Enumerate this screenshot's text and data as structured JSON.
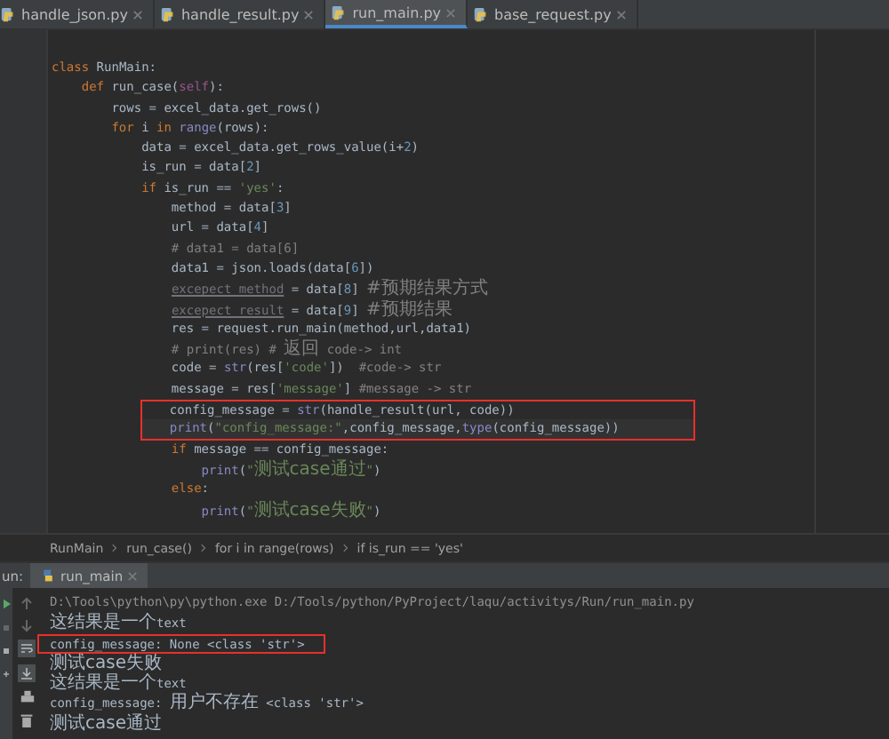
{
  "tabs": [
    {
      "label": "handle_json.py",
      "selected": false
    },
    {
      "label": "handle_result.py",
      "selected": false
    },
    {
      "label": "run_main.py",
      "selected": true
    },
    {
      "label": "base_request.py",
      "selected": false
    }
  ],
  "editor": {
    "lines": [
      {
        "current": false,
        "boxed": false,
        "tokens": [
          {
            "kind": "kw",
            "text": "class "
          },
          {
            "kind": "plain",
            "text": "RunMain:"
          }
        ]
      },
      {
        "current": false,
        "boxed": false,
        "tokens": [
          {
            "kind": "kw",
            "text": "    def "
          },
          {
            "kind": "plain",
            "text": "run_case("
          },
          {
            "kind": "self",
            "text": "self"
          },
          {
            "kind": "plain",
            "text": "):"
          }
        ]
      },
      {
        "current": false,
        "boxed": false,
        "tokens": [
          {
            "kind": "plain",
            "text": "        rows = excel_data.get_rows()"
          }
        ]
      },
      {
        "current": false,
        "boxed": false,
        "tokens": [
          {
            "kind": "kw",
            "text": "        for "
          },
          {
            "kind": "plain",
            "text": "i "
          },
          {
            "kind": "kw",
            "text": "in "
          },
          {
            "kind": "fn",
            "text": "range"
          },
          {
            "kind": "plain",
            "text": "(rows):"
          }
        ]
      },
      {
        "current": false,
        "boxed": false,
        "tokens": [
          {
            "kind": "plain",
            "text": "            data = excel_data.get_rows_value(i+"
          },
          {
            "kind": "num",
            "text": "2"
          },
          {
            "kind": "plain",
            "text": ")"
          }
        ]
      },
      {
        "current": false,
        "boxed": false,
        "tokens": [
          {
            "kind": "plain",
            "text": "            is_run = data["
          },
          {
            "kind": "num",
            "text": "2"
          },
          {
            "kind": "plain",
            "text": "]"
          }
        ]
      },
      {
        "current": false,
        "boxed": false,
        "tokens": [
          {
            "kind": "kw",
            "text": "            if "
          },
          {
            "kind": "plain",
            "text": "is_run == "
          },
          {
            "kind": "str",
            "text": "'yes'"
          },
          {
            "kind": "plain",
            "text": ":"
          }
        ]
      },
      {
        "current": false,
        "boxed": false,
        "tokens": [
          {
            "kind": "plain",
            "text": "                method = data["
          },
          {
            "kind": "num",
            "text": "3"
          },
          {
            "kind": "plain",
            "text": "]"
          }
        ]
      },
      {
        "current": false,
        "boxed": false,
        "tokens": [
          {
            "kind": "plain",
            "text": "                url = data["
          },
          {
            "kind": "num",
            "text": "4"
          },
          {
            "kind": "plain",
            "text": "]"
          }
        ]
      },
      {
        "current": false,
        "boxed": false,
        "tokens": [
          {
            "kind": "comment",
            "text": "                # data1 = data[6]"
          }
        ]
      },
      {
        "current": false,
        "boxed": false,
        "tokens": [
          {
            "kind": "plain",
            "text": "                data1 = json.loads(data["
          },
          {
            "kind": "num",
            "text": "6"
          },
          {
            "kind": "plain",
            "text": "])"
          }
        ]
      },
      {
        "current": false,
        "boxed": false,
        "tokens": [
          {
            "kind": "unused",
            "text": "                excepect_method"
          },
          {
            "kind": "plain",
            "text": " = data["
          },
          {
            "kind": "num",
            "text": "8"
          },
          {
            "kind": "plain",
            "text": "] "
          },
          {
            "kind": "comment-cjk",
            "text": "#预期结果方式"
          }
        ]
      },
      {
        "current": false,
        "boxed": false,
        "tokens": [
          {
            "kind": "unused",
            "text": "                excepect_result"
          },
          {
            "kind": "plain",
            "text": " = data["
          },
          {
            "kind": "num",
            "text": "9"
          },
          {
            "kind": "plain",
            "text": "] "
          },
          {
            "kind": "comment-cjk",
            "text": "#预期结果"
          }
        ]
      },
      {
        "current": false,
        "boxed": false,
        "tokens": [
          {
            "kind": "plain",
            "text": "                res = request.run_main(method,url,data1)"
          }
        ]
      },
      {
        "current": false,
        "boxed": false,
        "tokens": [
          {
            "kind": "comment",
            "text": "                # print(res) # "
          },
          {
            "kind": "comment-cjk",
            "text": "返回"
          },
          {
            "kind": "comment",
            "text": " code-> int"
          }
        ]
      },
      {
        "current": false,
        "boxed": false,
        "tokens": [
          {
            "kind": "plain",
            "text": "                code = "
          },
          {
            "kind": "fn",
            "text": "str"
          },
          {
            "kind": "plain",
            "text": "(res["
          },
          {
            "kind": "str",
            "text": "'code'"
          },
          {
            "kind": "plain",
            "text": "])  "
          },
          {
            "kind": "comment",
            "text": "#code-> str"
          }
        ]
      },
      {
        "current": false,
        "boxed": false,
        "tokens": [
          {
            "kind": "plain",
            "text": "                message = res["
          },
          {
            "kind": "str",
            "text": "'message'"
          },
          {
            "kind": "plain",
            "text": "] "
          },
          {
            "kind": "comment",
            "text": "#message -> str"
          }
        ]
      },
      {
        "current": false,
        "boxed": true,
        "tokens": [
          {
            "kind": "plain",
            "text": "                config_message = "
          },
          {
            "kind": "fn",
            "text": "str"
          },
          {
            "kind": "plain",
            "text": "(handle_result(url, code))"
          }
        ]
      },
      {
        "current": true,
        "boxed": true,
        "tokens": [
          {
            "kind": "fn",
            "text": "                print"
          },
          {
            "kind": "plain",
            "text": "("
          },
          {
            "kind": "str",
            "text": "\"config_message:\""
          },
          {
            "kind": "plain",
            "text": ",config_message,"
          },
          {
            "kind": "fn",
            "text": "type"
          },
          {
            "kind": "plain",
            "text": "(config_message))"
          }
        ]
      },
      {
        "current": false,
        "boxed": false,
        "tokens": [
          {
            "kind": "kw",
            "text": "                if "
          },
          {
            "kind": "plain",
            "text": "message == config_message:"
          }
        ]
      },
      {
        "current": false,
        "boxed": false,
        "tokens": [
          {
            "kind": "fn",
            "text": "                    print"
          },
          {
            "kind": "plain",
            "text": "("
          },
          {
            "kind": "str",
            "text": "\""
          },
          {
            "kind": "str-cjk",
            "text": "测试case通过"
          },
          {
            "kind": "str",
            "text": "\""
          },
          {
            "kind": "plain",
            "text": ")"
          }
        ]
      },
      {
        "current": false,
        "boxed": false,
        "tokens": [
          {
            "kind": "kw",
            "text": "                else"
          },
          {
            "kind": "plain",
            "text": ":"
          }
        ]
      },
      {
        "current": false,
        "boxed": false,
        "tokens": [
          {
            "kind": "fn",
            "text": "                    print"
          },
          {
            "kind": "plain",
            "text": "("
          },
          {
            "kind": "str",
            "text": "\""
          },
          {
            "kind": "str-cjk",
            "text": "测试case失败"
          },
          {
            "kind": "str",
            "text": "\""
          },
          {
            "kind": "plain",
            "text": ")"
          }
        ]
      }
    ]
  },
  "breadcrumbs": [
    "RunMain",
    "run_case()",
    "for i in range(rows)",
    "if is_run == 'yes'"
  ],
  "run_panel": {
    "label": "un:",
    "tab": "run_main",
    "console": [
      {
        "boxed": false,
        "kind": "command",
        "tokens": [
          {
            "kind": "latin",
            "text": "D:\\Tools\\python\\py\\python.exe D:/Tools/python/PyProject/laqu/activitys/Run/run_main.py"
          }
        ]
      },
      {
        "boxed": false,
        "kind": "output",
        "tokens": [
          {
            "kind": "cjk",
            "text": "这结果是一个"
          },
          {
            "kind": "latin",
            "text": "text"
          }
        ]
      },
      {
        "boxed": true,
        "kind": "output",
        "tokens": [
          {
            "kind": "latin",
            "text": "config_message: None <class 'str'>"
          }
        ]
      },
      {
        "boxed": false,
        "kind": "output",
        "tokens": [
          {
            "kind": "cjk",
            "text": "测试case失败"
          }
        ]
      },
      {
        "boxed": false,
        "kind": "output",
        "tokens": [
          {
            "kind": "cjk",
            "text": "这结果是一个"
          },
          {
            "kind": "latin",
            "text": "text"
          }
        ]
      },
      {
        "boxed": false,
        "kind": "output",
        "tokens": [
          {
            "kind": "latin",
            "text": "config_message: "
          },
          {
            "kind": "cjk",
            "text": "用户不存在"
          },
          {
            "kind": "latin",
            "text": " <class 'str'>"
          }
        ]
      },
      {
        "boxed": false,
        "kind": "output",
        "tokens": [
          {
            "kind": "cjk",
            "text": "测试case通过"
          }
        ]
      }
    ]
  }
}
